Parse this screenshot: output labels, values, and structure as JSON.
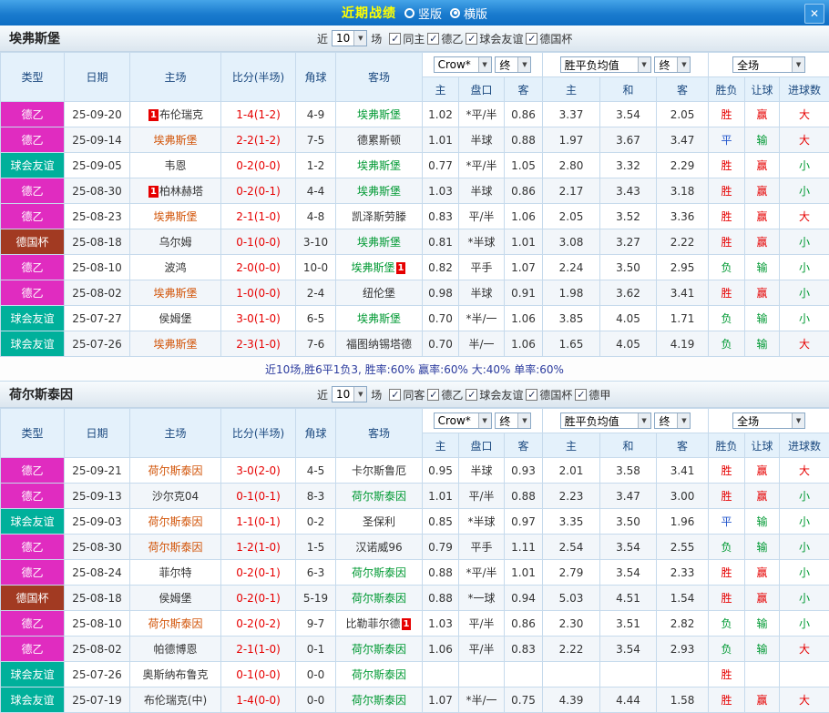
{
  "titlebar": {
    "title": "近期战绩",
    "options": [
      {
        "name": "vertical",
        "label": "竖版",
        "selected": false
      },
      {
        "name": "horizontal",
        "label": "横版",
        "selected": true
      }
    ]
  },
  "icons": {
    "close": "✕",
    "chevron_down": "▼",
    "check": "✓"
  },
  "type_colors": {
    "德乙": "#e02cc0",
    "球会友谊": "#00b09b",
    "德国杯": "#a23a22"
  },
  "team_colors": {
    "home_focus": "#d25408",
    "away_focus": "#009933",
    "score": "#e60000"
  },
  "result_colors": {
    "胜": "#e60000",
    "赢": "#e60000",
    "大": "#e60000",
    "平": "#2255cc",
    "负": "#009933",
    "输": "#009933",
    "小": "#009933"
  },
  "sections": [
    {
      "team": "埃弗斯堡",
      "near_label": "近",
      "games_value": "10",
      "games_label": "场",
      "checkboxes": [
        {
          "label": "同主",
          "checked": true
        },
        {
          "label": "德乙",
          "checked": true
        },
        {
          "label": "球会友谊",
          "checked": true
        },
        {
          "label": "德国杯",
          "checked": true
        }
      ],
      "selects": {
        "provider": "Crow*",
        "stage1": "终",
        "avg": "胜平负均值",
        "stage2": "终",
        "scope": "全场"
      },
      "header": {
        "type": "类型",
        "date": "日期",
        "home": "主场",
        "score": "比分(半场)",
        "corner": "角球",
        "away": "客场",
        "odds_home": "主",
        "odds_line": "盘口",
        "odds_away": "客",
        "avg_home": "主",
        "avg_draw": "和",
        "avg_away": "客",
        "wl": "胜负",
        "handicap": "让球",
        "goals": "进球数"
      },
      "rows": [
        {
          "type": "德乙",
          "date": "25-09-20",
          "home": "布伦瑞克",
          "home_focus": false,
          "home_badge": "1",
          "score": "1-4(1-2)",
          "corner": "4-9",
          "away": "埃弗斯堡",
          "away_focus": true,
          "odds": [
            "1.02",
            "*平/半",
            "0.86"
          ],
          "avg": [
            "3.37",
            "3.54",
            "2.05"
          ],
          "results": [
            "胜",
            "赢",
            "大"
          ]
        },
        {
          "type": "德乙",
          "date": "25-09-14",
          "home": "埃弗斯堡",
          "home_focus": true,
          "score": "2-2(1-2)",
          "corner": "7-5",
          "away": "德累斯顿",
          "away_focus": false,
          "odds": [
            "1.01",
            "半球",
            "0.88"
          ],
          "avg": [
            "1.97",
            "3.67",
            "3.47"
          ],
          "results": [
            "平",
            "输",
            "大"
          ]
        },
        {
          "type": "球会友谊",
          "date": "25-09-05",
          "home": "韦恩",
          "home_focus": false,
          "score": "0-2(0-0)",
          "corner": "1-2",
          "away": "埃弗斯堡",
          "away_focus": true,
          "odds": [
            "0.77",
            "*平/半",
            "1.05"
          ],
          "avg": [
            "2.80",
            "3.32",
            "2.29"
          ],
          "results": [
            "胜",
            "赢",
            "小"
          ]
        },
        {
          "type": "德乙",
          "date": "25-08-30",
          "home": "柏林赫塔",
          "home_focus": false,
          "home_badge": "1",
          "score": "0-2(0-1)",
          "corner": "4-4",
          "away": "埃弗斯堡",
          "away_focus": true,
          "odds": [
            "1.03",
            "半球",
            "0.86"
          ],
          "avg": [
            "2.17",
            "3.43",
            "3.18"
          ],
          "results": [
            "胜",
            "赢",
            "小"
          ]
        },
        {
          "type": "德乙",
          "date": "25-08-23",
          "home": "埃弗斯堡",
          "home_focus": true,
          "score": "2-1(1-0)",
          "corner": "4-8",
          "away": "凯泽斯劳滕",
          "away_focus": false,
          "odds": [
            "0.83",
            "平/半",
            "1.06"
          ],
          "avg": [
            "2.05",
            "3.52",
            "3.36"
          ],
          "results": [
            "胜",
            "赢",
            "大"
          ]
        },
        {
          "type": "德国杯",
          "date": "25-08-18",
          "home": "乌尔姆",
          "home_focus": false,
          "score": "0-1(0-0)",
          "corner": "3-10",
          "away": "埃弗斯堡",
          "away_focus": true,
          "odds": [
            "0.81",
            "*半球",
            "1.01"
          ],
          "avg": [
            "3.08",
            "3.27",
            "2.22"
          ],
          "results": [
            "胜",
            "赢",
            "小"
          ]
        },
        {
          "type": "德乙",
          "date": "25-08-10",
          "home": "波鸿",
          "home_focus": false,
          "score": "2-0(0-0)",
          "corner": "10-0",
          "away": "埃弗斯堡",
          "away_focus": true,
          "away_badge": "1",
          "odds": [
            "0.82",
            "平手",
            "1.07"
          ],
          "avg": [
            "2.24",
            "3.50",
            "2.95"
          ],
          "results": [
            "负",
            "输",
            "小"
          ]
        },
        {
          "type": "德乙",
          "date": "25-08-02",
          "home": "埃弗斯堡",
          "home_focus": true,
          "score": "1-0(0-0)",
          "corner": "2-4",
          "away": "纽伦堡",
          "away_focus": false,
          "odds": [
            "0.98",
            "半球",
            "0.91"
          ],
          "avg": [
            "1.98",
            "3.62",
            "3.41"
          ],
          "results": [
            "胜",
            "赢",
            "小"
          ]
        },
        {
          "type": "球会友谊",
          "date": "25-07-27",
          "home": "侯姆堡",
          "home_focus": false,
          "score": "3-0(1-0)",
          "corner": "6-5",
          "away": "埃弗斯堡",
          "away_focus": true,
          "odds": [
            "0.70",
            "*半/一",
            "1.06"
          ],
          "avg": [
            "3.85",
            "4.05",
            "1.71"
          ],
          "results": [
            "负",
            "输",
            "小"
          ]
        },
        {
          "type": "球会友谊",
          "date": "25-07-26",
          "home": "埃弗斯堡",
          "home_focus": true,
          "score": "2-3(1-0)",
          "corner": "7-6",
          "away": "福图纳锡塔德",
          "away_focus": false,
          "odds": [
            "0.70",
            "半/一",
            "1.06"
          ],
          "avg": [
            "1.65",
            "4.05",
            "4.19"
          ],
          "results": [
            "负",
            "输",
            "大"
          ]
        }
      ],
      "summary": "近10场,胜6平1负3, 胜率:60% 赢率:60% 大:40% 单率:60%"
    },
    {
      "team": "荷尔斯泰因",
      "near_label": "近",
      "games_value": "10",
      "games_label": "场",
      "checkboxes": [
        {
          "label": "同客",
          "checked": true
        },
        {
          "label": "德乙",
          "checked": true
        },
        {
          "label": "球会友谊",
          "checked": true
        },
        {
          "label": "德国杯",
          "checked": true
        },
        {
          "label": "德甲",
          "checked": true
        }
      ],
      "selects": {
        "provider": "Crow*",
        "stage1": "终",
        "avg": "胜平负均值",
        "stage2": "终",
        "scope": "全场"
      },
      "header": {
        "type": "类型",
        "date": "日期",
        "home": "主场",
        "score": "比分(半场)",
        "corner": "角球",
        "away": "客场",
        "odds_home": "主",
        "odds_line": "盘口",
        "odds_away": "客",
        "avg_home": "主",
        "avg_draw": "和",
        "avg_away": "客",
        "wl": "胜负",
        "handicap": "让球",
        "goals": "进球数"
      },
      "rows": [
        {
          "type": "德乙",
          "date": "25-09-21",
          "home": "荷尔斯泰因",
          "home_focus": true,
          "score": "3-0(2-0)",
          "corner": "4-5",
          "away": "卡尔斯鲁厄",
          "away_focus": false,
          "odds": [
            "0.95",
            "半球",
            "0.93"
          ],
          "avg": [
            "2.01",
            "3.58",
            "3.41"
          ],
          "results": [
            "胜",
            "赢",
            "大"
          ]
        },
        {
          "type": "德乙",
          "date": "25-09-13",
          "home": "沙尔克04",
          "home_focus": false,
          "score": "0-1(0-1)",
          "corner": "8-3",
          "away": "荷尔斯泰因",
          "away_focus": true,
          "odds": [
            "1.01",
            "平/半",
            "0.88"
          ],
          "avg": [
            "2.23",
            "3.47",
            "3.00"
          ],
          "results": [
            "胜",
            "赢",
            "小"
          ]
        },
        {
          "type": "球会友谊",
          "date": "25-09-03",
          "home": "荷尔斯泰因",
          "home_focus": true,
          "score": "1-1(0-1)",
          "corner": "0-2",
          "away": "圣保利",
          "away_focus": false,
          "odds": [
            "0.85",
            "*半球",
            "0.97"
          ],
          "avg": [
            "3.35",
            "3.50",
            "1.96"
          ],
          "results": [
            "平",
            "输",
            "小"
          ]
        },
        {
          "type": "德乙",
          "date": "25-08-30",
          "home": "荷尔斯泰因",
          "home_focus": true,
          "score": "1-2(1-0)",
          "corner": "1-5",
          "away": "汉诺威96",
          "away_focus": false,
          "odds": [
            "0.79",
            "平手",
            "1.11"
          ],
          "avg": [
            "2.54",
            "3.54",
            "2.55"
          ],
          "results": [
            "负",
            "输",
            "小"
          ]
        },
        {
          "type": "德乙",
          "date": "25-08-24",
          "home": "菲尔特",
          "home_focus": false,
          "score": "0-2(0-1)",
          "corner": "6-3",
          "away": "荷尔斯泰因",
          "away_focus": true,
          "odds": [
            "0.88",
            "*平/半",
            "1.01"
          ],
          "avg": [
            "2.79",
            "3.54",
            "2.33"
          ],
          "results": [
            "胜",
            "赢",
            "小"
          ]
        },
        {
          "type": "德国杯",
          "date": "25-08-18",
          "home": "侯姆堡",
          "home_focus": false,
          "score": "0-2(0-1)",
          "corner": "5-19",
          "away": "荷尔斯泰因",
          "away_focus": true,
          "odds": [
            "0.88",
            "*一球",
            "0.94"
          ],
          "avg": [
            "5.03",
            "4.51",
            "1.54"
          ],
          "results": [
            "胜",
            "赢",
            "小"
          ]
        },
        {
          "type": "德乙",
          "date": "25-08-10",
          "home": "荷尔斯泰因",
          "home_focus": true,
          "score": "0-2(0-2)",
          "corner": "9-7",
          "away": "比勒菲尔德",
          "away_focus": false,
          "away_badge": "1",
          "odds": [
            "1.03",
            "平/半",
            "0.86"
          ],
          "avg": [
            "2.30",
            "3.51",
            "2.82"
          ],
          "results": [
            "负",
            "输",
            "小"
          ]
        },
        {
          "type": "德乙",
          "date": "25-08-02",
          "home": "帕德博恩",
          "home_focus": false,
          "score": "2-1(1-0)",
          "corner": "0-1",
          "away": "荷尔斯泰因",
          "away_focus": true,
          "odds": [
            "1.06",
            "平/半",
            "0.83"
          ],
          "avg": [
            "2.22",
            "3.54",
            "2.93"
          ],
          "results": [
            "负",
            "输",
            "大"
          ]
        },
        {
          "type": "球会友谊",
          "date": "25-07-26",
          "home": "奥斯纳布鲁克",
          "home_focus": false,
          "score": "0-1(0-0)",
          "corner": "0-0",
          "away": "荷尔斯泰因",
          "away_focus": true,
          "odds": [
            "",
            "",
            ""
          ],
          "avg": [
            "",
            "",
            ""
          ],
          "results": [
            "胜",
            "",
            ""
          ]
        },
        {
          "type": "球会友谊",
          "date": "25-07-19",
          "home": "布伦瑞克(中)",
          "home_focus": false,
          "score": "1-4(0-0)",
          "corner": "0-0",
          "away": "荷尔斯泰因",
          "away_focus": true,
          "odds": [
            "1.07",
            "*半/一",
            "0.75"
          ],
          "avg": [
            "4.39",
            "4.44",
            "1.58"
          ],
          "results": [
            "胜",
            "赢",
            "大"
          ]
        }
      ]
    }
  ]
}
